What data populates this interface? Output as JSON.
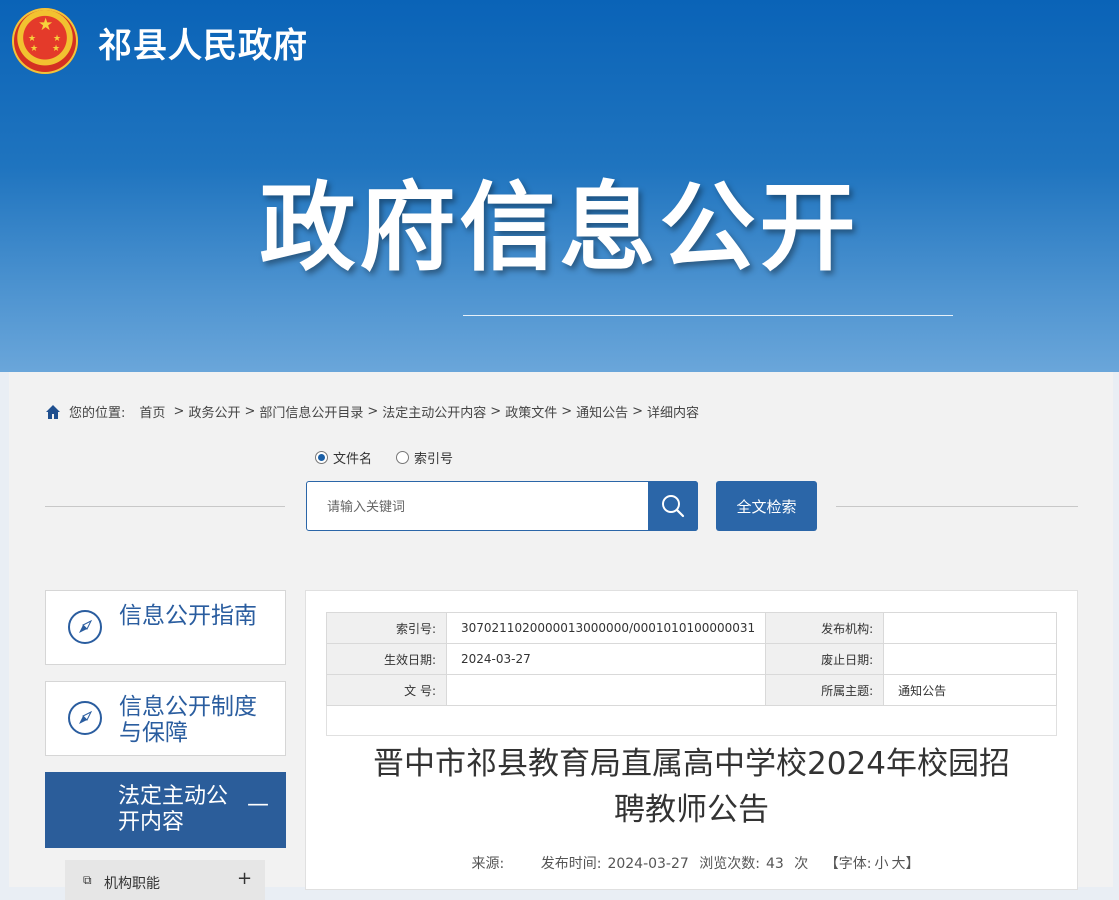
{
  "header": {
    "site_title": "祁县人民政府",
    "banner_title": "政府信息公开"
  },
  "breadcrumb": {
    "label": "您的位置:",
    "items": [
      "首页",
      "政务公开",
      "部门信息公开目录",
      "法定主动公开内容",
      "政策文件",
      "通知公告",
      "详细内容"
    ]
  },
  "search": {
    "options": [
      "文件名",
      "索引号"
    ],
    "selected": "文件名",
    "placeholder": "请输入关键词",
    "fulltext_label": "全文检索"
  },
  "sidebar": {
    "guide_label": "信息公开指南",
    "system_label": "信息公开制度与保障",
    "active_label": "法定主动公开内容",
    "active_toggle": "—",
    "sub_label": "机构职能",
    "sub_toggle": "+"
  },
  "meta": {
    "index_key": "索引号:",
    "index_value": "3070211020000013000000/0001010100000031",
    "publisher_key": "发布机构:",
    "publisher_value": "",
    "effective_key": "生效日期:",
    "effective_value": "2024-03-27",
    "expire_key": "废止日期:",
    "expire_value": "",
    "docno_key": "文  号:",
    "docno_value": "",
    "topic_key": "所属主题:",
    "topic_value": "通知公告"
  },
  "article": {
    "title_line1": "晋中市祁县教育局直属高中学校2024年校园招",
    "title_line2": "聘教师公告",
    "source_label": "来源:",
    "source_value": "",
    "time_label": "发布时间:",
    "time_value": "2024-03-27",
    "views_label": "浏览次数:",
    "views_value": "43",
    "views_unit": "次",
    "font_label": "【字体:",
    "font_small": "小",
    "font_large": "大",
    "font_close": "】"
  },
  "colors": {
    "primary": "#2b5d9a",
    "header_top": "#0a63b7",
    "header_bottom": "#6aa6da"
  }
}
